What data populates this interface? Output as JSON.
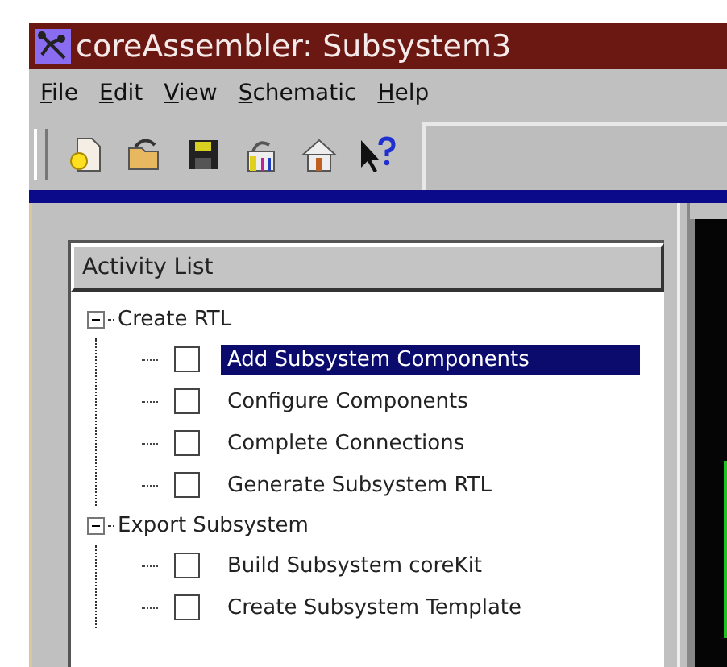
{
  "window": {
    "title": "coreAssembler: Subsystem3"
  },
  "menu": [
    "File",
    "Edit",
    "View",
    "Schematic",
    "Help"
  ],
  "toolbar": [
    {
      "kind": "new"
    },
    {
      "kind": "open"
    },
    {
      "kind": "save"
    },
    {
      "kind": "tools"
    },
    {
      "kind": "home"
    },
    {
      "kind": "help"
    }
  ],
  "activity_list": {
    "title": "Activity List",
    "items": [
      {
        "label": "Create RTL",
        "expanded": true,
        "children": [
          {
            "label": "Add Subsystem Components",
            "checked": false,
            "selected": true
          },
          {
            "label": "Configure Components",
            "checked": false,
            "selected": false
          },
          {
            "label": "Complete Connections",
            "checked": false,
            "selected": false
          },
          {
            "label": "Generate Subsystem RTL",
            "checked": false,
            "selected": false
          }
        ]
      },
      {
        "label": "Export Subsystem",
        "expanded": true,
        "children": [
          {
            "label": "Build Subsystem coreKit",
            "checked": false,
            "selected": false
          },
          {
            "label": "Create Subsystem Template",
            "checked": false,
            "selected": false
          }
        ]
      }
    ]
  }
}
